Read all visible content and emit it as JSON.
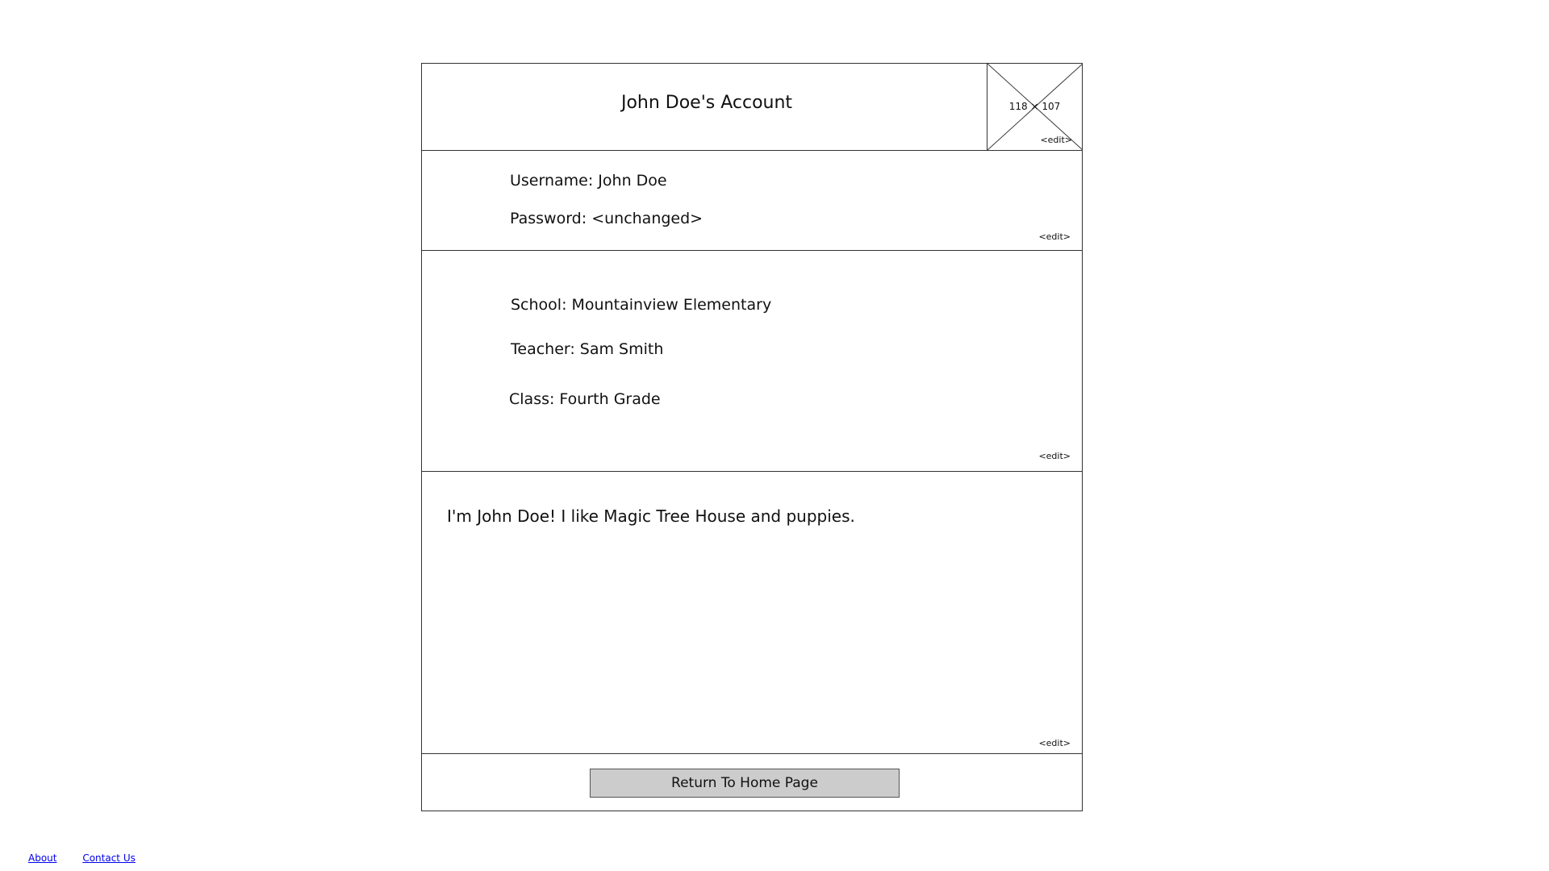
{
  "header": {
    "title": "John Doe's Account",
    "avatar_placeholder": "118 × 107",
    "avatar_edit": "<edit>"
  },
  "credentials": {
    "username": "Username: John Doe",
    "password": "Password: <unchanged>",
    "edit": "<edit>"
  },
  "school_info": {
    "school": "School: Mountainview Elementary",
    "teacher": "Teacher: Sam Smith",
    "class": "Class: Fourth Grade",
    "edit": "<edit>"
  },
  "bio": {
    "text": "I'm John Doe! I like Magic Tree House and puppies.",
    "edit": "<edit>"
  },
  "actions": {
    "home_button": "Return To Home Page"
  },
  "footer": {
    "about": "About",
    "contact": "Contact Us"
  }
}
